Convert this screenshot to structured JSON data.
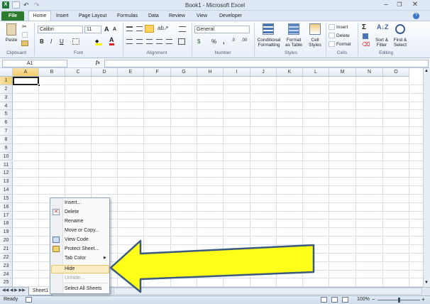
{
  "window": {
    "title": "Book1 - Microsoft Excel"
  },
  "tabs": [
    "File",
    "Home",
    "Insert",
    "Page Layout",
    "Formulas",
    "Data",
    "Review",
    "View",
    "Developer"
  ],
  "ribbon": {
    "clipboard": {
      "paste": "Paste",
      "label": "Clipboard"
    },
    "font": {
      "name": "Calibri",
      "size": "11",
      "label": "Font",
      "grow": "A",
      "shrink": "A",
      "bold": "B",
      "italic": "I",
      "underline": "U",
      "font_color_letter": "A"
    },
    "alignment": {
      "label": "Alignment"
    },
    "number": {
      "format": "General",
      "label": "Number",
      "currency": "$",
      "percent": "%",
      "comma": ","
    },
    "styles": {
      "conditional": [
        "Conditional",
        "Formatting"
      ],
      "format_table": [
        "Format",
        "as Table"
      ],
      "cell_styles": [
        "Cell",
        "Styles"
      ],
      "label": "Styles"
    },
    "cells": {
      "insert": "Insert",
      "delete": "Delete",
      "format": "Format",
      "label": "Cells"
    },
    "editing": {
      "sum": "Σ",
      "sort": [
        "Sort &",
        "Filter"
      ],
      "find": [
        "Find &",
        "Select"
      ],
      "label": "Editing"
    }
  },
  "formula_bar": {
    "name_box": "A1",
    "fx": "fx",
    "value": ""
  },
  "columns": [
    "A",
    "B",
    "C",
    "D",
    "E",
    "F",
    "G",
    "H",
    "I",
    "J",
    "K",
    "L",
    "M",
    "N",
    "O"
  ],
  "rows": [
    "1",
    "2",
    "3",
    "4",
    "5",
    "6",
    "7",
    "8",
    "9",
    "10",
    "11",
    "12",
    "13",
    "14",
    "15",
    "16",
    "17",
    "18",
    "19",
    "20",
    "21",
    "22",
    "23",
    "24",
    "25"
  ],
  "sheet_tab": "Sheet1",
  "status": {
    "ready": "Ready",
    "zoom": "100%",
    "zoom_minus": "−",
    "zoom_plus": "+"
  },
  "context_menu": {
    "items": [
      {
        "label": "Insert...",
        "accel": "I",
        "disabled": false
      },
      {
        "label": "Delete",
        "accel": "D",
        "disabled": false
      },
      {
        "label": "Rename",
        "accel": "R",
        "disabled": false
      },
      {
        "label": "Move or Copy...",
        "accel": "M",
        "disabled": false
      },
      {
        "label": "View Code",
        "accel": "V",
        "disabled": false
      },
      {
        "label": "Protect Sheet...",
        "accel": "P",
        "disabled": false
      },
      {
        "label": "Tab Color",
        "accel": "T",
        "disabled": false
      },
      {
        "label": "Hide",
        "accel": "H",
        "disabled": false
      },
      {
        "label": "Unhide...",
        "accel": "U",
        "disabled": true
      },
      {
        "label": "Select All Sheets",
        "accel": "S",
        "disabled": false
      }
    ],
    "highlighted": "Hide"
  },
  "colors": {
    "arrow_fill": "#ffff19",
    "arrow_stroke": "#3a5b7f",
    "file_tab": "#2b7a2e",
    "highlight": "#fcedc5"
  }
}
